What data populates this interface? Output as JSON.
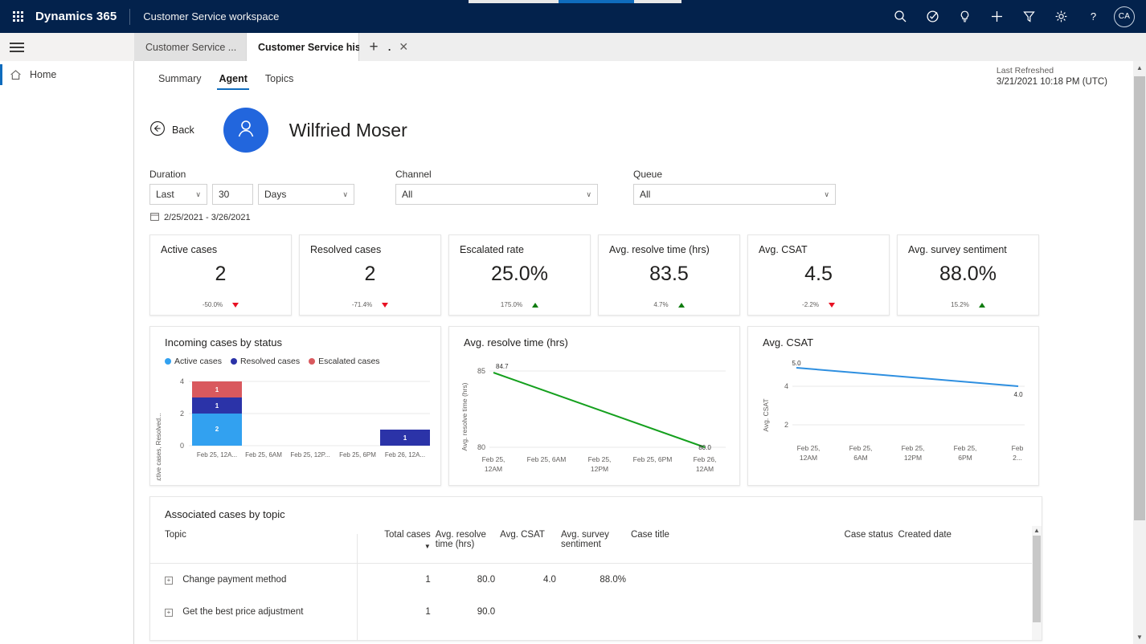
{
  "appbar": {
    "waffle_icon": "app-launcher-icon",
    "brand": "Dynamics 365",
    "subbrand": "Customer Service workspace",
    "icons": [
      {
        "name": "search-icon",
        "label": "Search"
      },
      {
        "name": "assistant-icon",
        "label": "Assistant"
      },
      {
        "name": "lightbulb-icon",
        "label": "Insights"
      },
      {
        "name": "plus-icon",
        "label": "Quick create"
      },
      {
        "name": "filter-icon",
        "label": "Filter"
      },
      {
        "name": "gear-icon",
        "label": "Settings"
      },
      {
        "name": "help-icon",
        "label": "Help"
      }
    ],
    "avatar_initials": "CA"
  },
  "tabs": {
    "hamburger_icon": "hamburger-icon",
    "items": [
      {
        "label": "Customer Service ...",
        "active": false,
        "closable": false
      },
      {
        "label": "Customer Service historic...",
        "active": true,
        "closable": true,
        "close_glyph": "✕"
      }
    ],
    "new_tab_glyph": "+"
  },
  "leftnav": {
    "items": [
      {
        "label": "Home",
        "icon": "home-icon",
        "active": true
      }
    ]
  },
  "dashboard": {
    "tabs": [
      {
        "label": "Summary",
        "active": false
      },
      {
        "label": "Agent",
        "active": true
      },
      {
        "label": "Topics",
        "active": false
      }
    ],
    "refresh_label": "Last Refreshed",
    "refresh_value": "3/21/2021 10:18 PM (UTC)"
  },
  "agent": {
    "back_label": "Back",
    "back_icon": "arrow-left-circle-icon",
    "avatar_icon": "person-icon",
    "name": "Wilfried Moser"
  },
  "filters": {
    "duration": {
      "label": "Duration",
      "operator": "Last",
      "amount": "30",
      "unit": "Days"
    },
    "channel": {
      "label": "Channel",
      "value": "All"
    },
    "queue": {
      "label": "Queue",
      "value": "All"
    },
    "date_range": "2/25/2021 - 3/26/2021",
    "date_range_icon": "calendar-icon",
    "chevron_glyph": "∨"
  },
  "kpis": [
    {
      "title": "Active cases",
      "value": "2",
      "delta": "-50.0%",
      "direction": "down"
    },
    {
      "title": "Resolved cases",
      "value": "2",
      "delta": "-71.4%",
      "direction": "down"
    },
    {
      "title": "Escalated rate",
      "value": "25.0%",
      "delta": "175.0%",
      "direction": "up"
    },
    {
      "title": "Avg. resolve time (hrs)",
      "value": "83.5",
      "delta": "4.7%",
      "direction": "up"
    },
    {
      "title": "Avg. CSAT",
      "value": "4.5",
      "delta": "-2.2%",
      "direction": "down"
    },
    {
      "title": "Avg. survey sentiment",
      "value": "88.0%",
      "delta": "15.2%",
      "direction": "up"
    }
  ],
  "chart_data": [
    {
      "id": "incoming-cases-by-status",
      "type": "bar",
      "stacked": true,
      "title": "Incoming cases by status",
      "xlabel": "",
      "ylabel": "Active cases, Resolved...",
      "ylim": [
        0,
        4
      ],
      "yticks": [
        0,
        2,
        4
      ],
      "grid": true,
      "legend_position": "top",
      "categories": [
        "Feb 25, 12A...",
        "Feb 25, 6AM",
        "Feb 25, 12P...",
        "Feb 25, 6PM",
        "Feb 26, 12A..."
      ],
      "series": [
        {
          "name": "Active cases",
          "color": "#32A1F0",
          "values": [
            2,
            0,
            0,
            0,
            0
          ]
        },
        {
          "name": "Resolved cases",
          "color": "#2B33A8",
          "values": [
            1,
            0,
            0,
            0,
            1
          ]
        },
        {
          "name": "Escalated cases",
          "color": "#D9595E",
          "values": [
            1,
            0,
            0,
            0,
            0
          ]
        }
      ],
      "data_labels": [
        "2",
        "1",
        "1",
        "1"
      ]
    },
    {
      "id": "avg-resolve-time",
      "type": "line",
      "title": "Avg. resolve time (hrs)",
      "xlabel": "",
      "ylabel": "Avg. resolve time (hrs)",
      "ylim": [
        80,
        85
      ],
      "yticks": [
        80,
        85
      ],
      "grid": true,
      "color": "#15A01E",
      "categories": [
        "Feb 25, 12AM",
        "Feb 25, 6AM",
        "Feb 25, 12PM",
        "Feb 25, 6PM",
        "Feb 26, 12AM"
      ],
      "values": [
        84.7,
        null,
        null,
        null,
        80.0
      ],
      "point_labels": [
        {
          "x": "Feb 25, 12AM",
          "text": "84.7"
        },
        {
          "x": "Feb 26, 12AM",
          "text": "80.0"
        }
      ]
    },
    {
      "id": "avg-csat",
      "type": "line",
      "title": "Avg. CSAT",
      "xlabel": "",
      "ylabel": "Avg. CSAT",
      "ylim": [
        0,
        5
      ],
      "yticks": [
        2,
        4
      ],
      "grid": true,
      "color": "#2E8FE0",
      "categories": [
        "Feb 25, 12AM",
        "Feb 25, 6AM",
        "Feb 25, 12PM",
        "Feb 25, 6PM",
        "Feb 2..."
      ],
      "values": [
        5.0,
        null,
        null,
        null,
        4.0
      ],
      "point_labels": [
        {
          "x": "Feb 25, 12AM",
          "text": "5.0"
        },
        {
          "x": "Feb 2...",
          "text": "4.0"
        }
      ]
    }
  ],
  "table": {
    "title": "Associated cases by topic",
    "sort_column": "Total cases",
    "sort_caret": "▼",
    "expander_glyph": "+",
    "columns": [
      "Topic",
      "Total cases",
      "Avg. resolve time (hrs)",
      "Avg. CSAT",
      "Avg. survey sentiment",
      "Case title",
      "Case status",
      "Created date"
    ],
    "rows": [
      {
        "topic": "Change payment method",
        "total_cases": "1",
        "avg_resolve_time": "80.0",
        "avg_csat": "4.0",
        "avg_survey_sentiment": "88.0%",
        "case_title": "",
        "case_status": "",
        "created_date": ""
      },
      {
        "topic": "Get the best price adjustment",
        "total_cases": "1",
        "avg_resolve_time": "90.0",
        "avg_csat": "",
        "avg_survey_sentiment": "",
        "case_title": "",
        "case_status": "",
        "created_date": ""
      }
    ]
  },
  "scrollbars": {
    "up_glyph": "▲",
    "down_glyph": "▼"
  },
  "colors": {
    "brand_bar": "#03224c",
    "accent": "#0f6cbd",
    "positive": "#107c10",
    "negative": "#e81123",
    "avatar": "#2266dd"
  }
}
